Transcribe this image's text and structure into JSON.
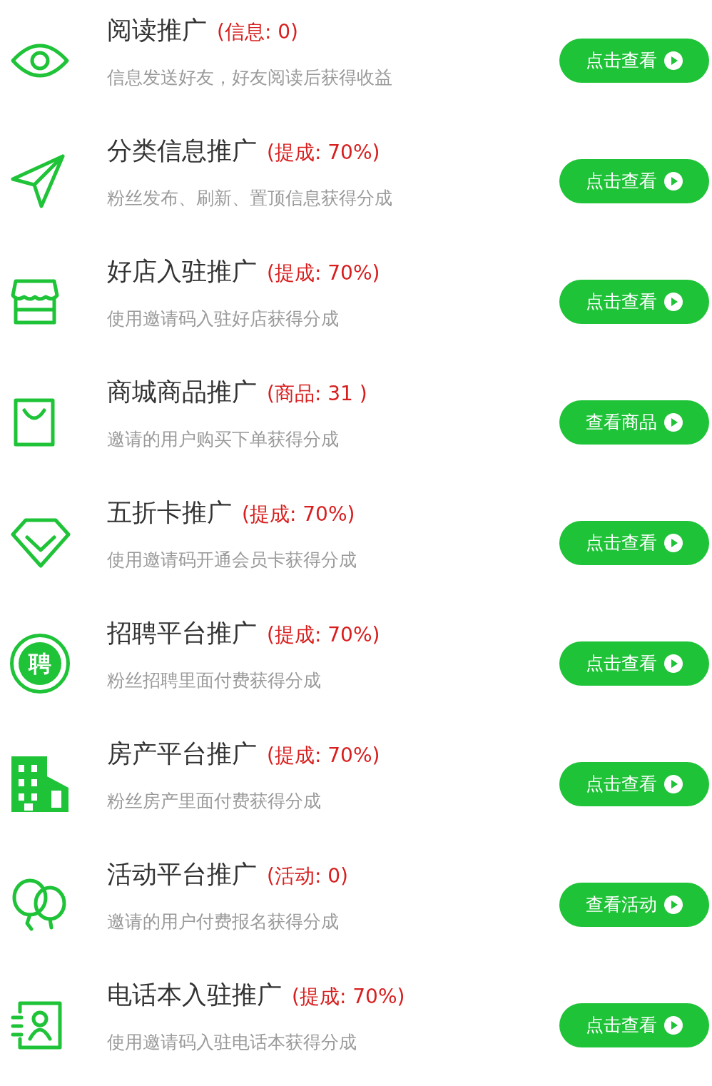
{
  "items": [
    {
      "kind": "eye",
      "title": "阅读推广",
      "note": "(信息: 0)",
      "desc": "信息发送好友，好友阅读后获得收益",
      "button": "点击查看"
    },
    {
      "kind": "send",
      "title": "分类信息推广",
      "note": "(提成: 70%)",
      "desc": "粉丝发布、刷新、置顶信息获得分成",
      "button": "点击查看"
    },
    {
      "kind": "store",
      "title": "好店入驻推广",
      "note": "(提成: 70%)",
      "desc": "使用邀请码入驻好店获得分成",
      "button": "点击查看"
    },
    {
      "kind": "bag",
      "title": "商城商品推广",
      "note": "(商品: 31 )",
      "desc": "邀请的用户购买下单获得分成",
      "button": "查看商品"
    },
    {
      "kind": "diamond",
      "title": "五折卡推广",
      "note": "(提成: 70%)",
      "desc": "使用邀请码开通会员卡获得分成",
      "button": "点击查看"
    },
    {
      "kind": "badge",
      "badge_text": "聘",
      "title": "招聘平台推广",
      "note": "(提成: 70%)",
      "desc": "粉丝招聘里面付费获得分成",
      "button": "点击查看"
    },
    {
      "kind": "building",
      "title": "房产平台推广",
      "note": "(提成: 70%)",
      "desc": "粉丝房产里面付费获得分成",
      "button": "点击查看"
    },
    {
      "kind": "balloons",
      "title": "活动平台推广",
      "note": "(活动: 0)",
      "desc": "邀请的用户付费报名获得分成",
      "button": "查看活动"
    },
    {
      "kind": "contact",
      "title": "电话本入驻推广",
      "note": "(提成: 70%)",
      "desc": "使用邀请码入驻电话本获得分成",
      "button": "点击查看"
    }
  ]
}
